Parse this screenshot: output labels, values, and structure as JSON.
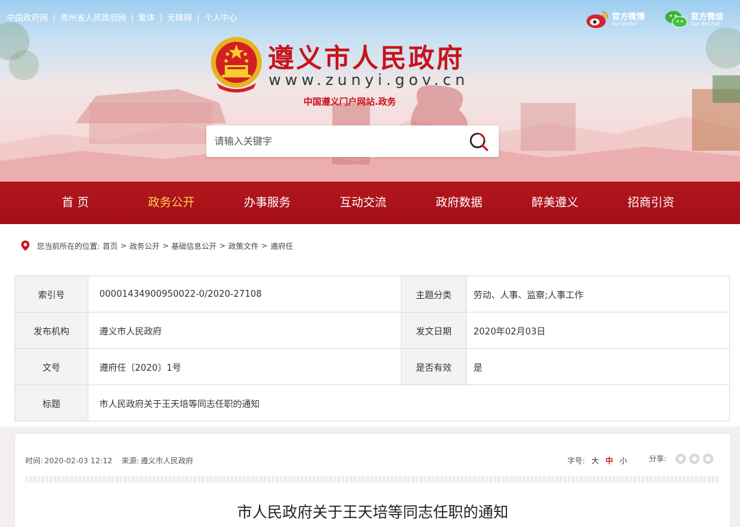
{
  "top_links": [
    "中国政府网",
    "贵州省人民政府网",
    "繁体",
    "无障碍",
    "个人中心"
  ],
  "social": [
    {
      "icon": "weibo-icon",
      "label": "官方微博",
      "sub": "Our Weibo"
    },
    {
      "icon": "wechat-icon",
      "label": "官方微信",
      "sub": "Our WeChat"
    }
  ],
  "site": {
    "title": "遵义市人民政府",
    "url": "www.zunyi.gov.cn",
    "subtitle": "中国遵义门户网站.政务"
  },
  "search": {
    "placeholder": "请输入关键字"
  },
  "nav": [
    "首 页",
    "政务公开",
    "办事服务",
    "互动交流",
    "政府数据",
    "醉美遵义",
    "招商引资"
  ],
  "nav_active": "政务公开",
  "breadcrumb": {
    "prefix": "您当前所在的位置:",
    "items": [
      "首页",
      "政务公开",
      "基础信息公开",
      "政策文件",
      "遵府任"
    ]
  },
  "info": {
    "index_label": "索引号",
    "index_value": "00001434900950022-0/2020-27108",
    "topic_label": "主题分类",
    "topic_value": "劳动、人事、监察;人事工作",
    "issuer_label": "发布机构",
    "issuer_value": "遵义市人民政府",
    "date_label": "发文日期",
    "date_value": "2020年02月03日",
    "docno_label": "文号",
    "docno_value": "遵府任〔2020〕1号",
    "valid_label": "是否有效",
    "valid_value": "是",
    "title_label": "标题",
    "title_value": "市人民政府关于王天培等同志任职的通知"
  },
  "article": {
    "time_label": "时间:",
    "time_value": "2020-02-03 12:12",
    "source_label": "来源:",
    "source_value": "遵义市人民政府",
    "fontsize_label": "字号:",
    "fontsize_options": [
      "大",
      "中",
      "小"
    ],
    "fontsize_selected": "中",
    "share_label": "分享:",
    "title": "市人民政府关于王天培等同志任职的通知"
  },
  "colors": {
    "brand_red": "#c8121b",
    "nav_bg": "#ad141c",
    "nav_active": "#ffd24a"
  }
}
